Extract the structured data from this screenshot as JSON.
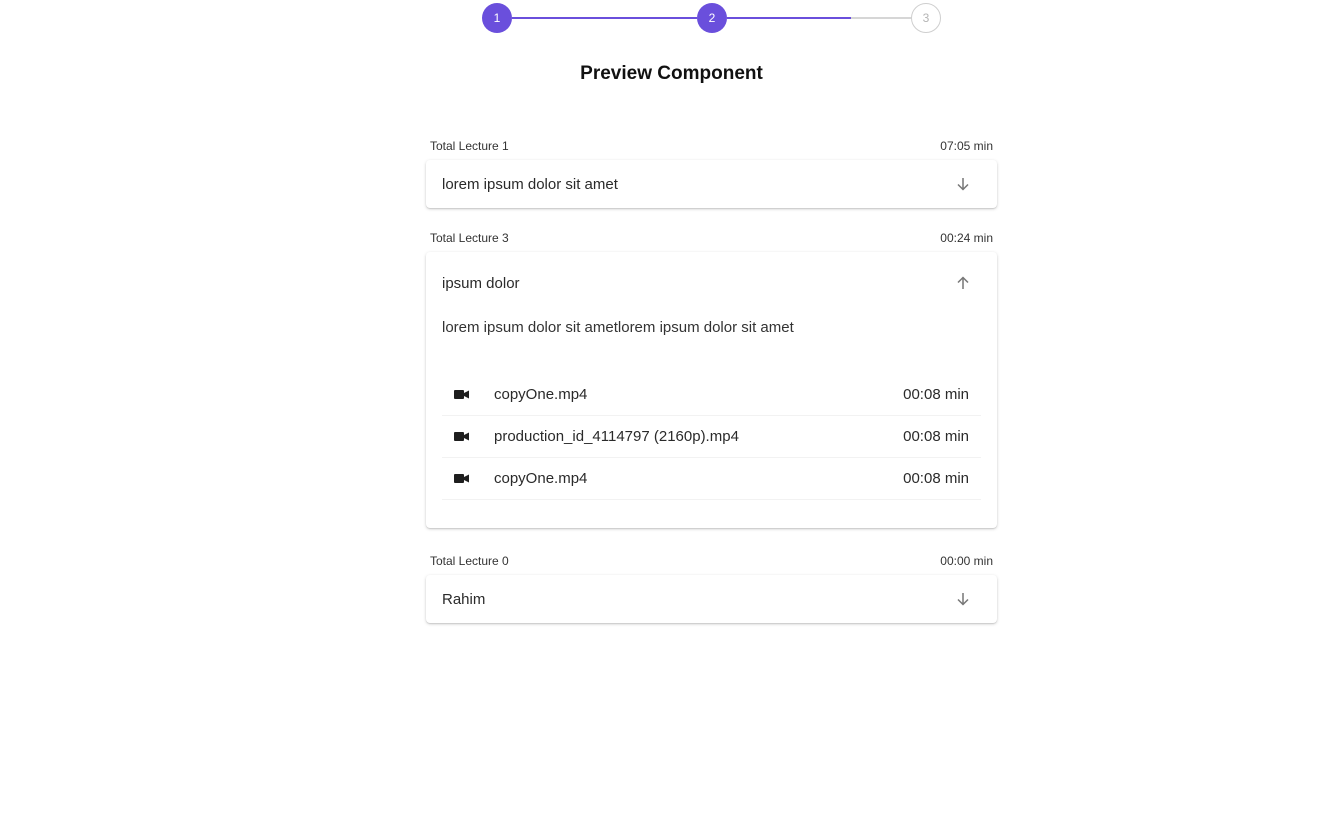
{
  "stepper": {
    "steps": [
      "1",
      "2",
      "3"
    ],
    "current_step": 2,
    "progress": 0.75,
    "active_color": "#6a4fdc"
  },
  "page_title": "Preview Component",
  "sections": [
    {
      "meta_left": "Total Lecture 1",
      "meta_right": "07:05 min",
      "title": "lorem ipsum dolor sit amet",
      "expanded": false,
      "icon": "arrow-down-icon"
    },
    {
      "meta_left": "Total Lecture 3",
      "meta_right": "00:24 min",
      "title": "ipsum dolor",
      "expanded": true,
      "icon": "arrow-up-icon",
      "description": "lorem ipsum dolor sit ametlorem ipsum dolor sit amet",
      "lectures": [
        {
          "name": "copyOne.mp4",
          "duration": "00:08 min",
          "icon": "video-camera-icon"
        },
        {
          "name": "production_id_4114797 (2160p).mp4",
          "duration": "00:08 min",
          "icon": "video-camera-icon"
        },
        {
          "name": "copyOne.mp4",
          "duration": "00:08 min",
          "icon": "video-camera-icon"
        }
      ]
    },
    {
      "meta_left": "Total Lecture 0",
      "meta_right": "00:00 min",
      "title": "Rahim",
      "expanded": false,
      "icon": "arrow-down-icon"
    }
  ]
}
